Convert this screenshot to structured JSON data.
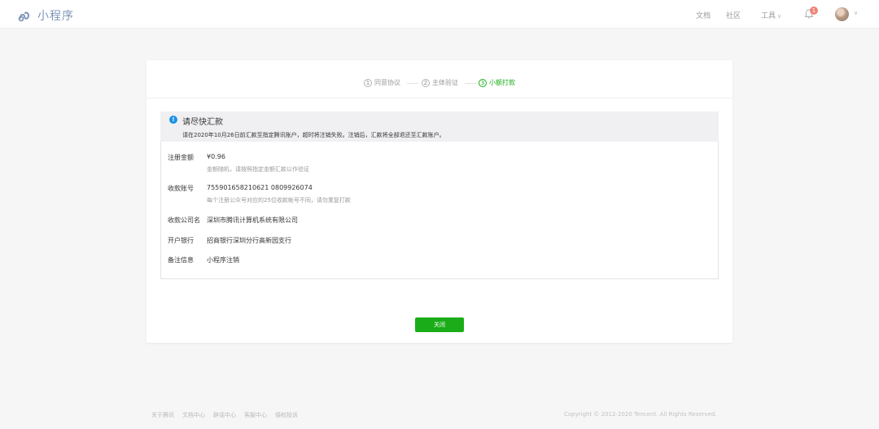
{
  "header": {
    "logo_text": "小程序",
    "nav": {
      "docs": "文档",
      "community": "社区",
      "tools": "工具"
    },
    "notification_count": "1"
  },
  "steps": [
    {
      "number": "1",
      "label": "同意协议",
      "active": false
    },
    {
      "number": "2",
      "label": "主体验证",
      "active": false
    },
    {
      "number": "3",
      "label": "小额打款",
      "active": true
    }
  ],
  "notice": {
    "title": "请尽快汇款",
    "description": "请在2020年10月26日前汇款至指定腾讯账户，超时将注销失败。注销后，汇款将全部退还至汇款账户。"
  },
  "info": {
    "amount": {
      "label": "注册金额",
      "value": "¥0.96",
      "note": "金额随机，请按照指定金额汇款以作验证"
    },
    "account": {
      "label": "收款账号",
      "value": "755901658210621 0809926074",
      "note": "每个注册公众号对应的25位收款帐号不同，请勿重复打款"
    },
    "company": {
      "label": "收款公司名",
      "value": "深圳市腾讯计算机系统有限公司"
    },
    "bank": {
      "label": "开户银行",
      "value": "招商银行深圳分行高新园支行"
    },
    "remark": {
      "label": "备注信息",
      "value": "小程序注销"
    }
  },
  "close_button": "关闭",
  "footer": {
    "links": [
      "关于腾讯",
      "文档中心",
      "辟谣中心",
      "客服中心",
      "侵权投诉"
    ],
    "copyright": "Copyright © 2012-2020 Tencent. All Rights Reserved."
  },
  "colors": {
    "accent_green": "#1aad19",
    "info_blue": "#1c91e6",
    "badge_red": "#f08378"
  }
}
